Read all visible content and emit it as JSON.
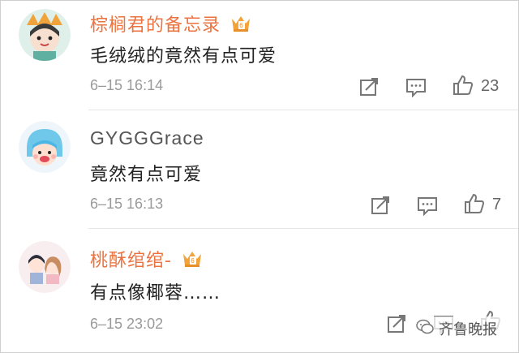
{
  "comments": [
    {
      "username": "棕榈君的备忘录",
      "has_crown_badge": true,
      "crown_badge_text": "6",
      "text": "毛绒绒的竟然有点可爱",
      "timestamp": "6–15 16:14",
      "like_count": "23",
      "name_color": "#eb7340"
    },
    {
      "username": "GYGGGrace",
      "has_crown_badge": false,
      "text": "竟然有点可爱",
      "timestamp": "6–15 16:13",
      "like_count": "7",
      "name_color": "#555555"
    },
    {
      "username": "桃酥绾绾-",
      "has_crown_badge": true,
      "crown_badge_text": "6",
      "text": "有点像椰蓉……",
      "timestamp": "6–15 23:02",
      "like_count": "",
      "name_color": "#eb7340"
    }
  ],
  "watermark": {
    "icon": "wechat-icon",
    "text": "齐鲁晚报"
  }
}
